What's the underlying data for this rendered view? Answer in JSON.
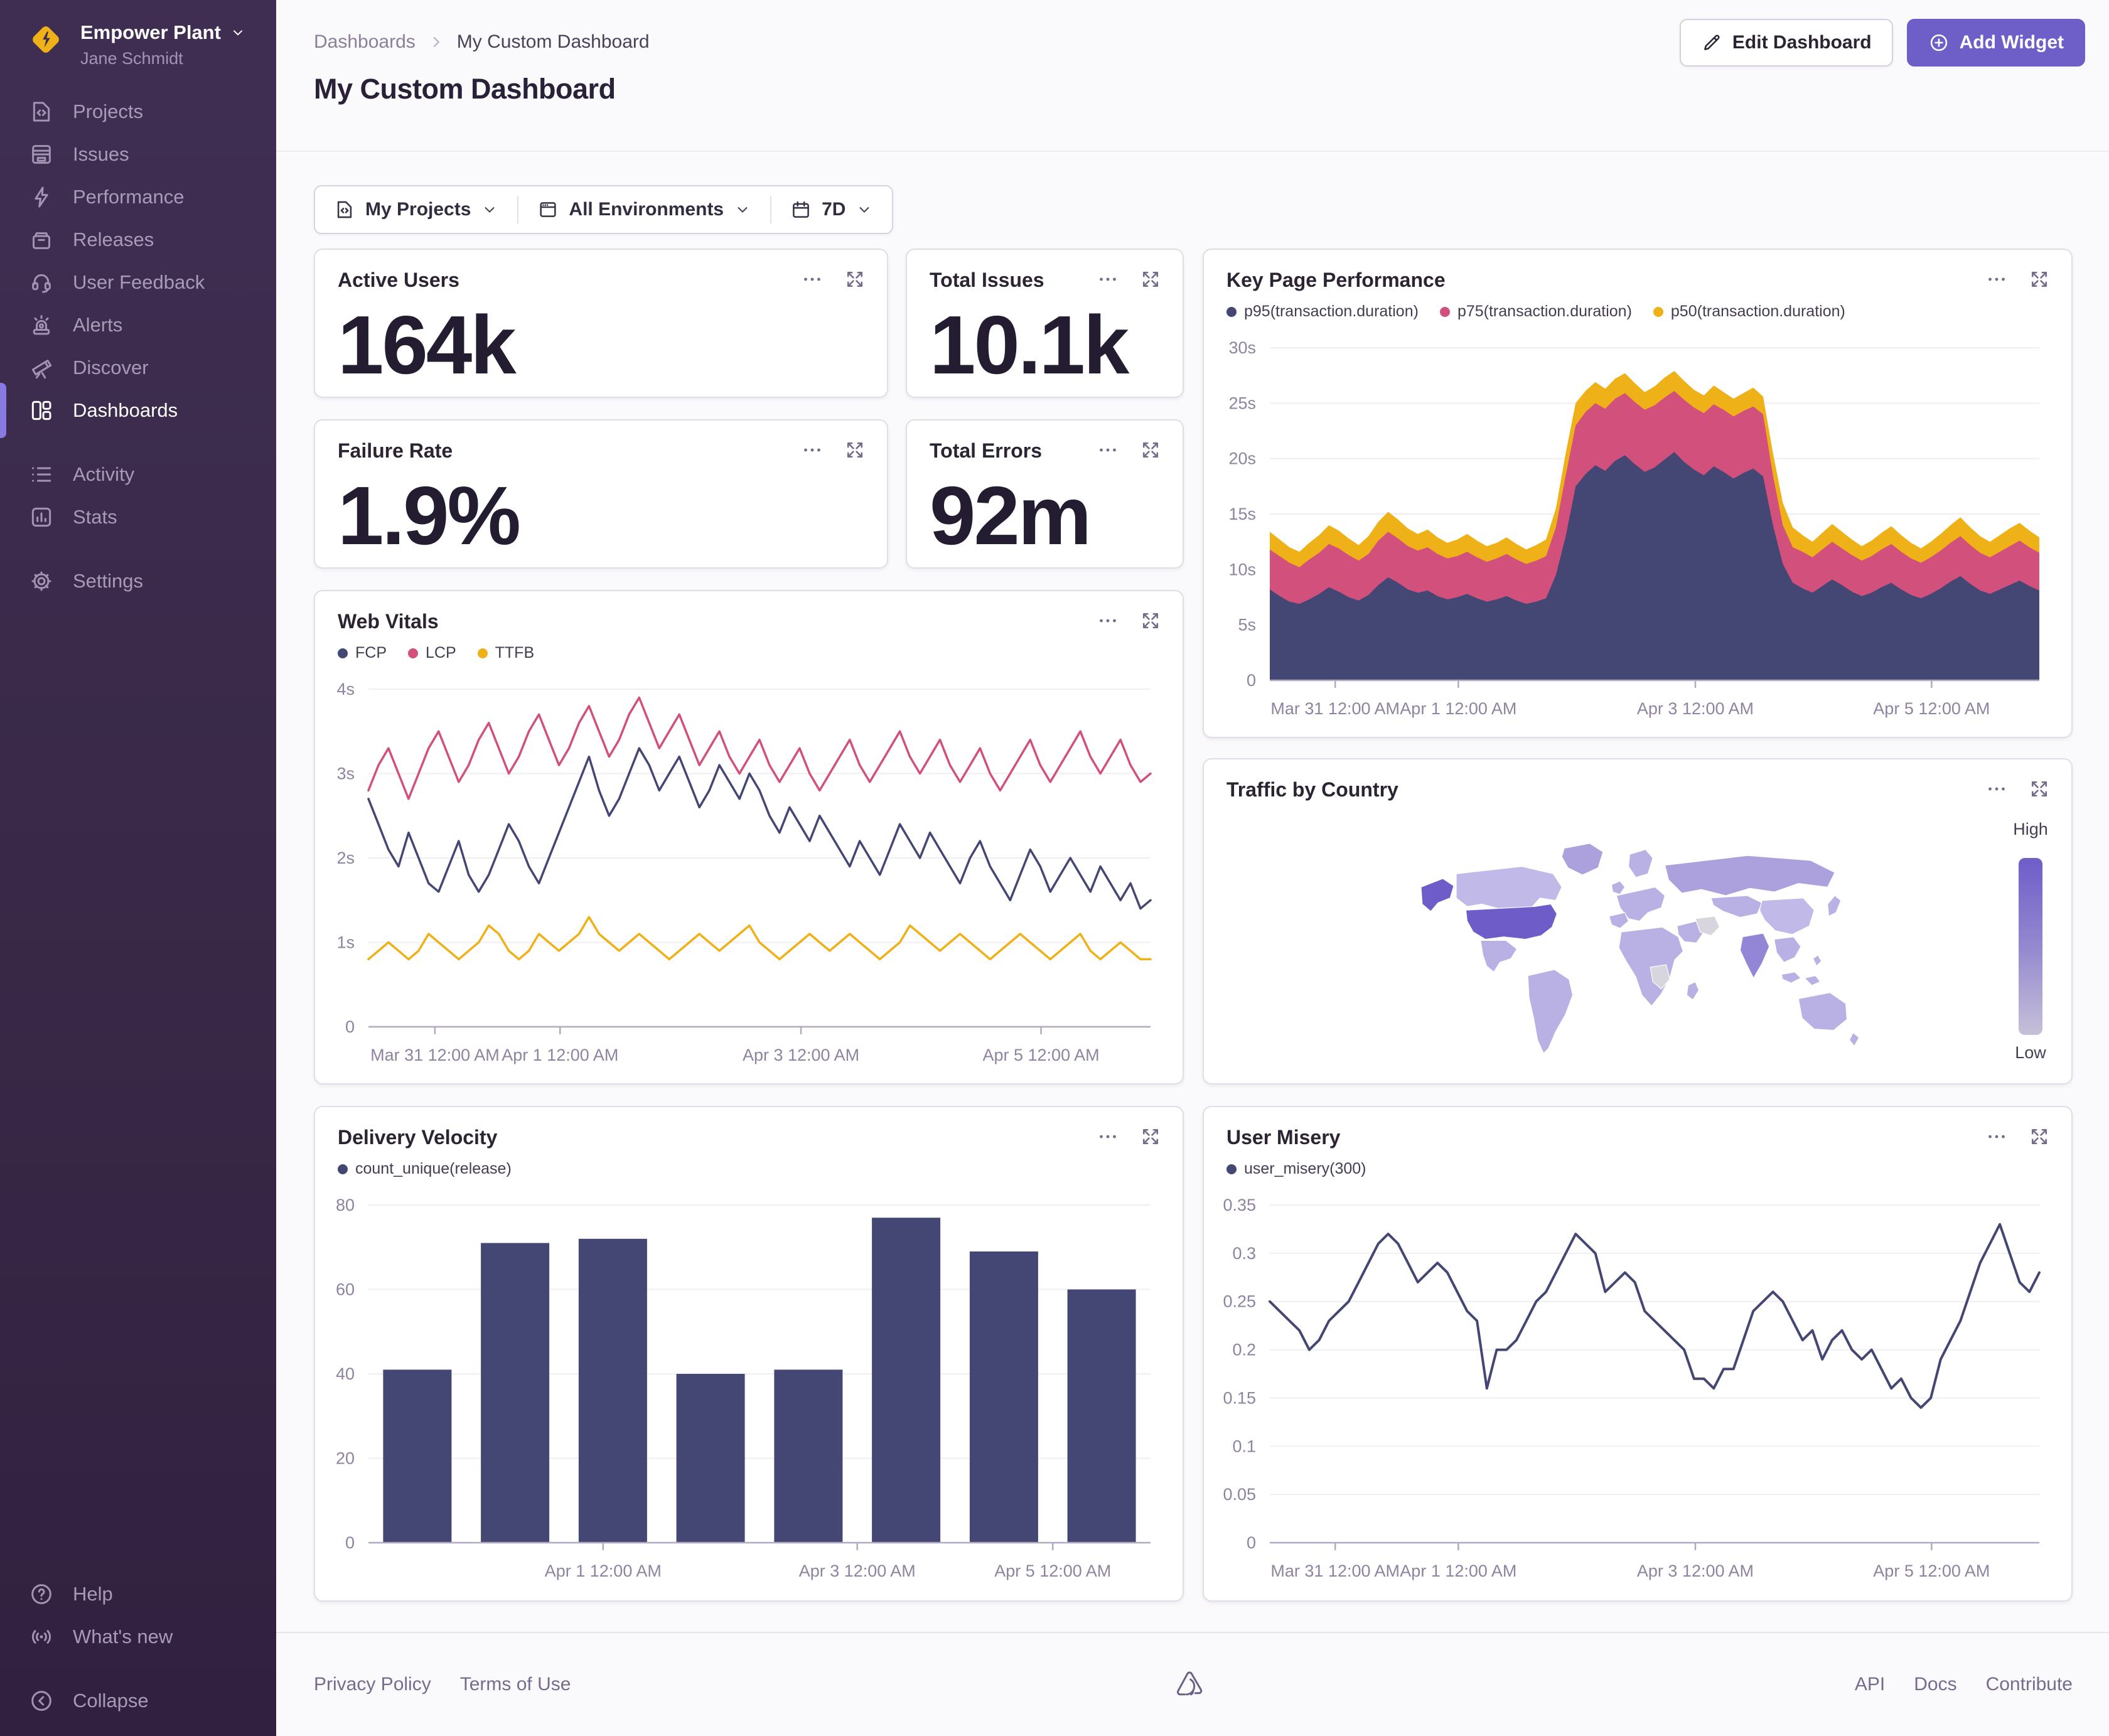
{
  "theme": {
    "accent": "#6d5fc7"
  },
  "sidebar": {
    "org": {
      "name": "Empower Plant",
      "user": "Jane Schmidt"
    },
    "items": [
      {
        "label": "Projects"
      },
      {
        "label": "Issues"
      },
      {
        "label": "Performance"
      },
      {
        "label": "Releases"
      },
      {
        "label": "User Feedback"
      },
      {
        "label": "Alerts"
      },
      {
        "label": "Discover"
      },
      {
        "label": "Dashboards",
        "active": true
      },
      {
        "label": "Activity"
      },
      {
        "label": "Stats"
      },
      {
        "label": "Settings"
      }
    ],
    "footer_items": [
      {
        "label": "Help"
      },
      {
        "label": "What's new"
      },
      {
        "label": "Collapse"
      }
    ]
  },
  "header": {
    "breadcrumb": {
      "root": "Dashboards",
      "current": "My Custom Dashboard"
    },
    "title": "My Custom Dashboard",
    "edit_button": "Edit Dashboard",
    "add_button": "Add Widget"
  },
  "filters": {
    "projects": "My Projects",
    "environments": "All Environments",
    "period": "7D"
  },
  "kpis": [
    {
      "title": "Active Users",
      "value": "164k"
    },
    {
      "title": "Total Issues",
      "value": "10.1k"
    },
    {
      "title": "Failure Rate",
      "value": "1.9%"
    },
    {
      "title": "Total Errors",
      "value": "92m"
    }
  ],
  "footer": {
    "left": [
      "Privacy Policy",
      "Terms of Use"
    ],
    "right": [
      "API",
      "Docs",
      "Contribute"
    ]
  },
  "chart_data": [
    {
      "id": "key_page_performance",
      "type": "area",
      "title": "Key Page Performance",
      "ylim": [
        0,
        30
      ],
      "y_ticks": [
        {
          "v": 0,
          "label": "0"
        },
        {
          "v": 5,
          "label": "5s"
        },
        {
          "v": 10,
          "label": "10s"
        },
        {
          "v": 15,
          "label": "15s"
        },
        {
          "v": 20,
          "label": "20s"
        },
        {
          "v": 25,
          "label": "25s"
        },
        {
          "v": 30,
          "label": "30s"
        }
      ],
      "x_ticks": [
        {
          "f": 0.085,
          "label": "Mar 31 12:00 AM"
        },
        {
          "f": 0.245,
          "label": "Apr 1 12:00 AM"
        },
        {
          "f": 0.553,
          "label": "Apr 3 12:00 AM"
        },
        {
          "f": 0.86,
          "label": "Apr 5 12:00 AM"
        }
      ],
      "series": [
        {
          "name": "p95(transaction.duration)",
          "color": "#444674",
          "values": [
            8.2,
            7.6,
            7.1,
            6.9,
            7.3,
            7.8,
            8.4,
            8.0,
            7.5,
            7.2,
            7.7,
            8.6,
            9.3,
            8.8,
            8.2,
            7.9,
            8.1,
            7.6,
            7.3,
            7.5,
            7.8,
            7.4,
            7.1,
            7.3,
            7.6,
            7.2,
            6.9,
            7.1,
            7.4,
            9.5,
            13.0,
            17.5,
            18.6,
            19.4,
            18.9,
            19.8,
            20.3,
            19.5,
            18.8,
            19.2,
            19.9,
            20.6,
            19.7,
            19.0,
            18.5,
            19.3,
            18.8,
            18.2,
            18.7,
            19.1,
            18.4,
            14.0,
            10.5,
            8.8,
            8.3,
            7.9,
            8.5,
            9.1,
            8.6,
            8.0,
            7.6,
            7.9,
            8.4,
            8.8,
            8.2,
            7.7,
            7.4,
            7.8,
            8.3,
            8.9,
            9.4,
            8.7,
            8.1,
            7.8,
            8.2,
            8.6,
            9.0,
            8.5,
            8.1
          ]
        },
        {
          "name": "p75(transaction.duration)",
          "color": "#d2517c",
          "values": [
            11.8,
            11.2,
            10.6,
            10.2,
            10.9,
            11.5,
            12.3,
            11.9,
            11.3,
            10.8,
            11.4,
            12.6,
            13.4,
            12.8,
            12.1,
            11.7,
            12.0,
            11.4,
            11.0,
            11.2,
            11.6,
            11.1,
            10.7,
            11.0,
            11.4,
            10.9,
            10.5,
            10.8,
            11.2,
            13.8,
            18.5,
            23.0,
            24.2,
            25.0,
            24.5,
            25.4,
            25.9,
            25.1,
            24.4,
            24.8,
            25.5,
            26.1,
            25.3,
            24.6,
            24.1,
            24.9,
            24.4,
            23.8,
            24.3,
            24.7,
            24.0,
            18.5,
            14.0,
            12.0,
            11.6,
            11.1,
            11.8,
            12.5,
            11.9,
            11.3,
            10.8,
            11.2,
            11.8,
            12.3,
            11.6,
            11.0,
            10.6,
            11.1,
            11.7,
            12.4,
            13.0,
            12.2,
            11.5,
            11.1,
            11.6,
            12.1,
            12.6,
            12.0,
            11.5
          ]
        },
        {
          "name": "p50(transaction.duration)",
          "color": "#efb118",
          "values": [
            13.4,
            12.7,
            12.0,
            11.6,
            12.4,
            13.1,
            14.0,
            13.5,
            12.8,
            12.2,
            13.0,
            14.3,
            15.2,
            14.5,
            13.7,
            13.2,
            13.6,
            12.9,
            12.4,
            12.7,
            13.2,
            12.6,
            12.1,
            12.4,
            12.9,
            12.3,
            11.8,
            12.2,
            12.7,
            15.5,
            20.5,
            25.0,
            26.1,
            26.9,
            26.3,
            27.2,
            27.7,
            26.8,
            26.0,
            26.5,
            27.3,
            27.9,
            27.0,
            26.2,
            25.7,
            26.6,
            26.0,
            25.4,
            25.9,
            26.4,
            25.6,
            20.5,
            16.0,
            13.8,
            13.1,
            12.5,
            13.3,
            14.1,
            13.4,
            12.7,
            12.1,
            12.6,
            13.3,
            13.9,
            13.1,
            12.4,
            11.9,
            12.5,
            13.2,
            14.0,
            14.7,
            13.8,
            13.0,
            12.5,
            13.1,
            13.7,
            14.2,
            13.5,
            12.9
          ]
        }
      ]
    },
    {
      "id": "web_vitals",
      "type": "line",
      "title": "Web Vitals",
      "ylim": [
        0,
        4
      ],
      "y_ticks": [
        {
          "v": 0,
          "label": "0"
        },
        {
          "v": 1,
          "label": "1s"
        },
        {
          "v": 2,
          "label": "2s"
        },
        {
          "v": 3,
          "label": "3s"
        },
        {
          "v": 4,
          "label": "4s"
        }
      ],
      "x_ticks": [
        {
          "f": 0.085,
          "label": "Mar 31 12:00 AM"
        },
        {
          "f": 0.245,
          "label": "Apr 1 12:00 AM"
        },
        {
          "f": 0.553,
          "label": "Apr 3 12:00 AM"
        },
        {
          "f": 0.86,
          "label": "Apr 5 12:00 AM"
        }
      ],
      "series": [
        {
          "name": "FCP",
          "color": "#444674",
          "width": 3.5,
          "values": [
            2.7,
            2.4,
            2.1,
            1.9,
            2.3,
            2.0,
            1.7,
            1.6,
            1.9,
            2.2,
            1.8,
            1.6,
            1.8,
            2.1,
            2.4,
            2.2,
            1.9,
            1.7,
            2.0,
            2.3,
            2.6,
            2.9,
            3.2,
            2.8,
            2.5,
            2.7,
            3.0,
            3.3,
            3.1,
            2.8,
            3.0,
            3.2,
            2.9,
            2.6,
            2.8,
            3.1,
            2.9,
            2.7,
            3.0,
            2.8,
            2.5,
            2.3,
            2.6,
            2.4,
            2.2,
            2.5,
            2.3,
            2.1,
            1.9,
            2.2,
            2.0,
            1.8,
            2.1,
            2.4,
            2.2,
            2.0,
            2.3,
            2.1,
            1.9,
            1.7,
            2.0,
            2.2,
            1.9,
            1.7,
            1.5,
            1.8,
            2.1,
            1.9,
            1.6,
            1.8,
            2.0,
            1.8,
            1.6,
            1.9,
            1.7,
            1.5,
            1.7,
            1.4,
            1.5
          ]
        },
        {
          "name": "LCP",
          "color": "#d2517c",
          "width": 3.5,
          "values": [
            2.8,
            3.1,
            3.3,
            3.0,
            2.7,
            3.0,
            3.3,
            3.5,
            3.2,
            2.9,
            3.1,
            3.4,
            3.6,
            3.3,
            3.0,
            3.2,
            3.5,
            3.7,
            3.4,
            3.1,
            3.3,
            3.6,
            3.8,
            3.5,
            3.2,
            3.4,
            3.7,
            3.9,
            3.6,
            3.3,
            3.5,
            3.7,
            3.4,
            3.1,
            3.3,
            3.5,
            3.2,
            3.0,
            3.2,
            3.4,
            3.1,
            2.9,
            3.1,
            3.3,
            3.0,
            2.8,
            3.0,
            3.2,
            3.4,
            3.1,
            2.9,
            3.1,
            3.3,
            3.5,
            3.2,
            3.0,
            3.2,
            3.4,
            3.1,
            2.9,
            3.1,
            3.3,
            3.0,
            2.8,
            3.0,
            3.2,
            3.4,
            3.1,
            2.9,
            3.1,
            3.3,
            3.5,
            3.2,
            3.0,
            3.2,
            3.4,
            3.1,
            2.9,
            3.0
          ]
        },
        {
          "name": "TTFB",
          "color": "#efb118",
          "width": 3.5,
          "values": [
            0.8,
            0.9,
            1.0,
            0.9,
            0.8,
            0.9,
            1.1,
            1.0,
            0.9,
            0.8,
            0.9,
            1.0,
            1.2,
            1.1,
            0.9,
            0.8,
            0.9,
            1.1,
            1.0,
            0.9,
            1.0,
            1.1,
            1.3,
            1.1,
            1.0,
            0.9,
            1.0,
            1.1,
            1.0,
            0.9,
            0.8,
            0.9,
            1.0,
            1.1,
            1.0,
            0.9,
            1.0,
            1.1,
            1.2,
            1.0,
            0.9,
            0.8,
            0.9,
            1.0,
            1.1,
            1.0,
            0.9,
            1.0,
            1.1,
            1.0,
            0.9,
            0.8,
            0.9,
            1.0,
            1.2,
            1.1,
            1.0,
            0.9,
            1.0,
            1.1,
            1.0,
            0.9,
            0.8,
            0.9,
            1.0,
            1.1,
            1.0,
            0.9,
            0.8,
            0.9,
            1.0,
            1.1,
            0.9,
            0.8,
            0.9,
            1.0,
            0.9,
            0.8,
            0.8
          ]
        }
      ]
    },
    {
      "id": "traffic_by_country",
      "type": "choropleth",
      "title": "Traffic by Country",
      "legend": {
        "high": "High",
        "low": "Low"
      },
      "colors": {
        "high": "#6e5cc8",
        "medium": "#9486d6",
        "mid": "#aca1dc",
        "base": "#b9b0e4",
        "light": "#c1b9e8",
        "muted": "#d9d5df"
      },
      "regions": {
        "high": [
          "United States"
        ],
        "medium": [
          "India"
        ],
        "no_data": [
          "Iran",
          "DR Congo"
        ]
      }
    },
    {
      "id": "delivery_velocity",
      "type": "bar",
      "title": "Delivery Velocity",
      "ylim": [
        0,
        80
      ],
      "y_ticks": [
        {
          "v": 0,
          "label": "0"
        },
        {
          "v": 20,
          "label": "20"
        },
        {
          "v": 40,
          "label": "40"
        },
        {
          "v": 60,
          "label": "60"
        },
        {
          "v": 80,
          "label": "80"
        }
      ],
      "x_ticks": [
        {
          "f": 0.3,
          "label": "Apr 1 12:00 AM"
        },
        {
          "f": 0.625,
          "label": "Apr 3 12:00 AM"
        },
        {
          "f": 0.875,
          "label": "Apr 5 12:00 AM"
        }
      ],
      "series": [
        {
          "name": "count_unique(release)",
          "color": "#444674",
          "values": [
            41,
            71,
            72,
            40,
            41,
            77,
            69,
            60
          ]
        }
      ]
    },
    {
      "id": "user_misery",
      "type": "line",
      "title": "User Misery",
      "ylim": [
        0,
        0.35
      ],
      "y_ticks": [
        {
          "v": 0,
          "label": "0"
        },
        {
          "v": 0.05,
          "label": "0.05"
        },
        {
          "v": 0.1,
          "label": "0.1"
        },
        {
          "v": 0.15,
          "label": "0.15"
        },
        {
          "v": 0.2,
          "label": "0.2"
        },
        {
          "v": 0.25,
          "label": "0.25"
        },
        {
          "v": 0.3,
          "label": "0.3"
        },
        {
          "v": 0.35,
          "label": "0.35"
        }
      ],
      "x_ticks": [
        {
          "f": 0.085,
          "label": "Mar 31 12:00 AM"
        },
        {
          "f": 0.245,
          "label": "Apr 1 12:00 AM"
        },
        {
          "f": 0.553,
          "label": "Apr 3 12:00 AM"
        },
        {
          "f": 0.86,
          "label": "Apr 5 12:00 AM"
        }
      ],
      "series": [
        {
          "name": "user_misery(300)",
          "color": "#444674",
          "width": 4,
          "values": [
            0.25,
            0.24,
            0.23,
            0.22,
            0.2,
            0.21,
            0.23,
            0.24,
            0.25,
            0.27,
            0.29,
            0.31,
            0.32,
            0.31,
            0.29,
            0.27,
            0.28,
            0.29,
            0.28,
            0.26,
            0.24,
            0.23,
            0.16,
            0.2,
            0.2,
            0.21,
            0.23,
            0.25,
            0.26,
            0.28,
            0.3,
            0.32,
            0.31,
            0.3,
            0.26,
            0.27,
            0.28,
            0.27,
            0.24,
            0.23,
            0.22,
            0.21,
            0.2,
            0.17,
            0.17,
            0.16,
            0.18,
            0.18,
            0.21,
            0.24,
            0.25,
            0.26,
            0.25,
            0.23,
            0.21,
            0.22,
            0.19,
            0.21,
            0.22,
            0.2,
            0.19,
            0.2,
            0.18,
            0.16,
            0.17,
            0.15,
            0.14,
            0.15,
            0.19,
            0.21,
            0.23,
            0.26,
            0.29,
            0.31,
            0.33,
            0.3,
            0.27,
            0.26,
            0.28
          ]
        }
      ]
    }
  ]
}
